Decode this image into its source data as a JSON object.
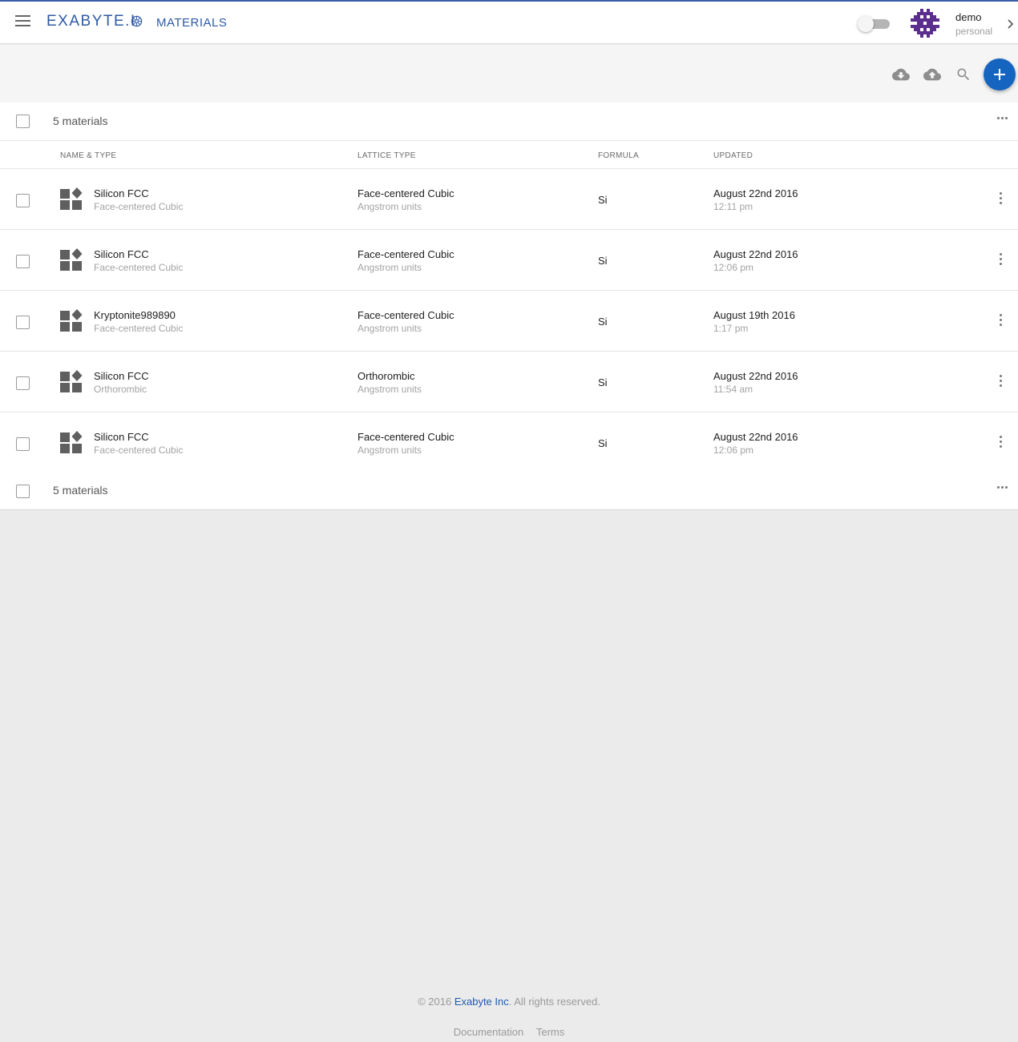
{
  "header": {
    "logo_text": "EXABYTE.I",
    "page_title": "MATERIALS",
    "user": {
      "name": "demo",
      "account": "personal"
    }
  },
  "toolbar": {
    "icons": [
      "cloud-download-icon",
      "cloud-upload-icon",
      "search-icon",
      "add-icon"
    ],
    "accent_color": "#1565c0"
  },
  "list": {
    "count_label_top": "5 materials",
    "count_label_bottom": "5 materials",
    "columns": [
      "NAME & TYPE",
      "LATTICE TYPE",
      "FORMULA",
      "UPDATED"
    ],
    "rows": [
      {
        "name": "Silicon FCC",
        "type": "Face-centered Cubic",
        "lattice": "Face-centered Cubic",
        "units": "Angstrom units",
        "formula": "Si",
        "date": "August 22nd 2016",
        "time": "12:11 pm"
      },
      {
        "name": "Silicon FCC",
        "type": "Face-centered Cubic",
        "lattice": "Face-centered Cubic",
        "units": "Angstrom units",
        "formula": "Si",
        "date": "August 22nd 2016",
        "time": "12:06 pm"
      },
      {
        "name": "Kryptonite989890",
        "type": "Face-centered Cubic",
        "lattice": "Face-centered Cubic",
        "units": "Angstrom units",
        "formula": "Si",
        "date": "August 19th 2016",
        "time": "1:17 pm"
      },
      {
        "name": "Silicon FCC",
        "type": "Orthorombic",
        "lattice": "Orthorombic",
        "units": "Angstrom units",
        "formula": "Si",
        "date": "August 22nd 2016",
        "time": "11:54 am"
      },
      {
        "name": "Silicon FCC",
        "type": "Face-centered Cubic",
        "lattice": "Face-centered Cubic",
        "units": "Angstrom units",
        "formula": "Si",
        "date": "August 22nd 2016",
        "time": "12:06 pm"
      }
    ]
  },
  "footer": {
    "copyright_prefix": "© 2016 ",
    "company": "Exabyte Inc",
    "copyright_suffix": ". All rights reserved.",
    "links": [
      "Documentation",
      "Terms"
    ]
  }
}
